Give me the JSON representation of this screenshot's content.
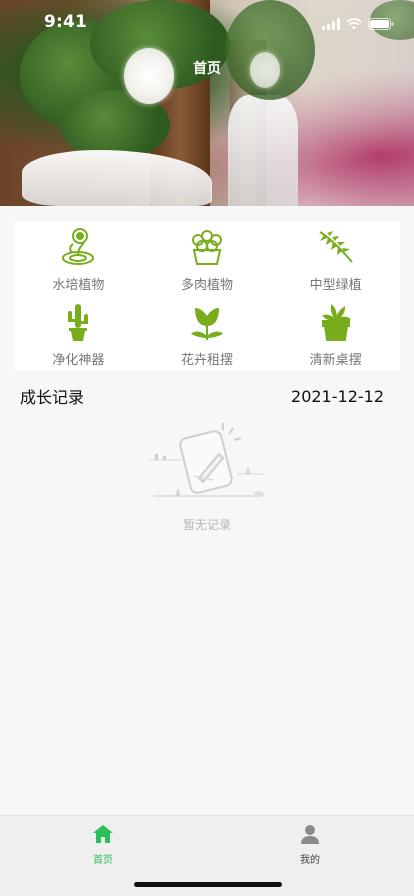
{
  "status_bar": {
    "time": "9:41"
  },
  "nav": {
    "title": "首页"
  },
  "categories": [
    {
      "label": "水培植物",
      "icon": "hydroponic-plant-icon"
    },
    {
      "label": "多肉植物",
      "icon": "succulent-plant-icon"
    },
    {
      "label": "中型绿植",
      "icon": "fern-leaf-icon"
    },
    {
      "label": "净化神器",
      "icon": "cactus-pot-icon"
    },
    {
      "label": "花卉租摆",
      "icon": "tulip-icon"
    },
    {
      "label": "清新桌摆",
      "icon": "desk-plant-pot-icon"
    }
  ],
  "growth": {
    "title": "成长记录",
    "date": "2021-12-12",
    "empty_text": "暂无记录"
  },
  "tabbar": {
    "home_label": "首页",
    "mine_label": "我的"
  },
  "colors": {
    "accent_green": "#2cc05a",
    "icon_green": "#7aad1e",
    "inactive_gray": "#8a8a8a"
  }
}
